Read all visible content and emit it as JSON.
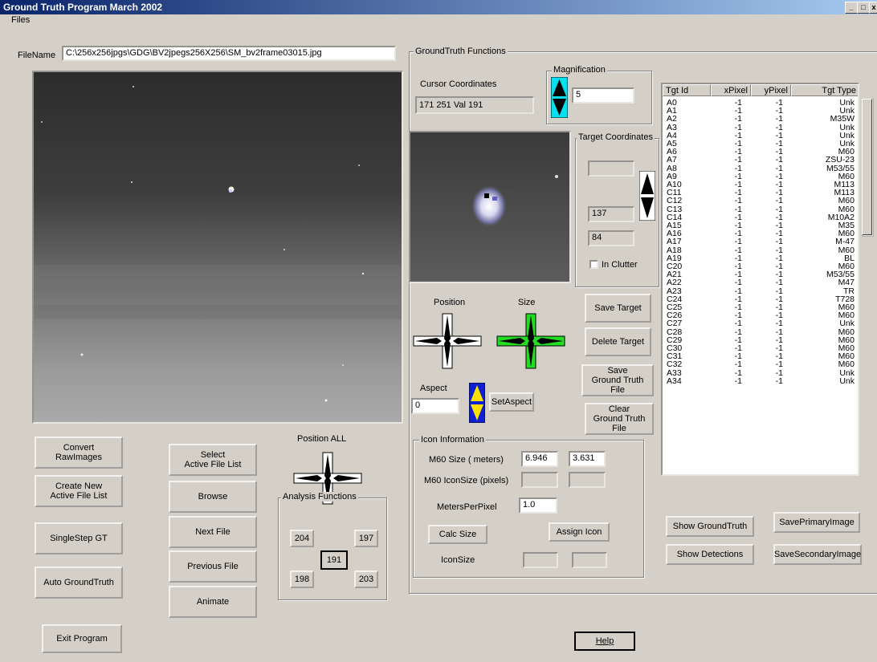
{
  "window": {
    "title": "Ground Truth Program  March 2002"
  },
  "menu": {
    "files": "Files"
  },
  "filename": {
    "label": "FileName",
    "value": "C:\\256x256jpgs\\GDG\\BV2jpegs256X256\\SM_bv2frame03015.jpg"
  },
  "left_buttons": {
    "convert": "Convert\nRawImages",
    "create_new": "Create New\nActive File List",
    "singlestep": "SingleStep GT",
    "auto_gt": "Auto GroundTruth",
    "exit": "Exit Program"
  },
  "mid_buttons": {
    "select": "Select\nActive File List",
    "browse": "Browse",
    "next": "Next File",
    "previous": "Previous File",
    "animate": "Animate"
  },
  "position_all": {
    "label": "Position ALL"
  },
  "analysis": {
    "label": "Analysis Functions",
    "tl": "204",
    "tr": "197",
    "center": "191",
    "bl": "198",
    "br": "203"
  },
  "gt_functions": {
    "label": "GroundTruth Functions",
    "cursor_label": "Cursor Coordinates",
    "cursor_value": "171 251 Val 191",
    "magnification_label": "Magnification",
    "magnification_value": "5",
    "target_coords_label": "Target Coordinates",
    "target_x": "",
    "target_y1": "137",
    "target_y2": "84",
    "in_clutter": "In Clutter",
    "position_label": "Position",
    "size_label": "Size",
    "aspect_label": "Aspect",
    "aspect_value": "0",
    "set_aspect": "SetAspect",
    "save_target": "Save Target",
    "delete_target": "Delete Target",
    "save_gt_file": "Save\nGround Truth\nFile",
    "clear_gt_file": "Clear\nGround Truth\nFile"
  },
  "icon_info": {
    "label": "Icon Information",
    "size_label": "M60  Size ( meters)",
    "size_w": "6.946",
    "size_h": "3.631",
    "iconsize_label": "M60  IconSize (pixels)",
    "mpp_label": "MetersPerPixel",
    "mpp_value": "1.0",
    "calc_size": "Calc Size",
    "assign_icon": "Assign Icon",
    "icon_size_label": "IconSize"
  },
  "target_table": {
    "headers": [
      "Tgt Id",
      "xPixel",
      "yPixel",
      "Tgt Type"
    ],
    "rows": [
      [
        "A0",
        "-1",
        "-1",
        "Unk"
      ],
      [
        "A1",
        "-1",
        "-1",
        "Unk"
      ],
      [
        "A2",
        "-1",
        "-1",
        "M35W"
      ],
      [
        "A3",
        "-1",
        "-1",
        "Unk"
      ],
      [
        "A4",
        "-1",
        "-1",
        "Unk"
      ],
      [
        "A5",
        "-1",
        "-1",
        "Unk"
      ],
      [
        "A6",
        "-1",
        "-1",
        "M60"
      ],
      [
        "A7",
        "-1",
        "-1",
        "ZSU-23"
      ],
      [
        "A8",
        "-1",
        "-1",
        "M53/55"
      ],
      [
        "A9",
        "-1",
        "-1",
        "M60"
      ],
      [
        "A10",
        "-1",
        "-1",
        "M113"
      ],
      [
        "C11",
        "-1",
        "-1",
        "M113"
      ],
      [
        "C12",
        "-1",
        "-1",
        "M60"
      ],
      [
        "C13",
        "-1",
        "-1",
        "M60"
      ],
      [
        "C14",
        "-1",
        "-1",
        "M10A2"
      ],
      [
        "A15",
        "-1",
        "-1",
        "M35"
      ],
      [
        "A16",
        "-1",
        "-1",
        "M60"
      ],
      [
        "A17",
        "-1",
        "-1",
        "M-47"
      ],
      [
        "A18",
        "-1",
        "-1",
        "M60"
      ],
      [
        "A19",
        "-1",
        "-1",
        "BL"
      ],
      [
        "C20",
        "-1",
        "-1",
        "M60"
      ],
      [
        "A21",
        "-1",
        "-1",
        "M53/55"
      ],
      [
        "A22",
        "-1",
        "-1",
        "M47"
      ],
      [
        "A23",
        "-1",
        "-1",
        "TR"
      ],
      [
        "C24",
        "-1",
        "-1",
        "T728"
      ],
      [
        "C25",
        "-1",
        "-1",
        "M60"
      ],
      [
        "C26",
        "-1",
        "-1",
        "M60"
      ],
      [
        "C27",
        "-1",
        "-1",
        "Unk"
      ],
      [
        "C28",
        "-1",
        "-1",
        "M60"
      ],
      [
        "C29",
        "-1",
        "-1",
        "M60"
      ],
      [
        "C30",
        "-1",
        "-1",
        "M60"
      ],
      [
        "C31",
        "-1",
        "-1",
        "M60"
      ],
      [
        "C32",
        "-1",
        "-1",
        "M60"
      ],
      [
        "A33",
        "-1",
        "-1",
        "Unk"
      ],
      [
        "A34",
        "-1",
        "-1",
        "Unk"
      ]
    ]
  },
  "right_buttons": {
    "show_gt": "Show GroundTruth",
    "save_primary": "SavePrimaryImage",
    "show_detections": "Show Detections",
    "save_secondary": "SaveSecondaryImage"
  },
  "help": "Help"
}
